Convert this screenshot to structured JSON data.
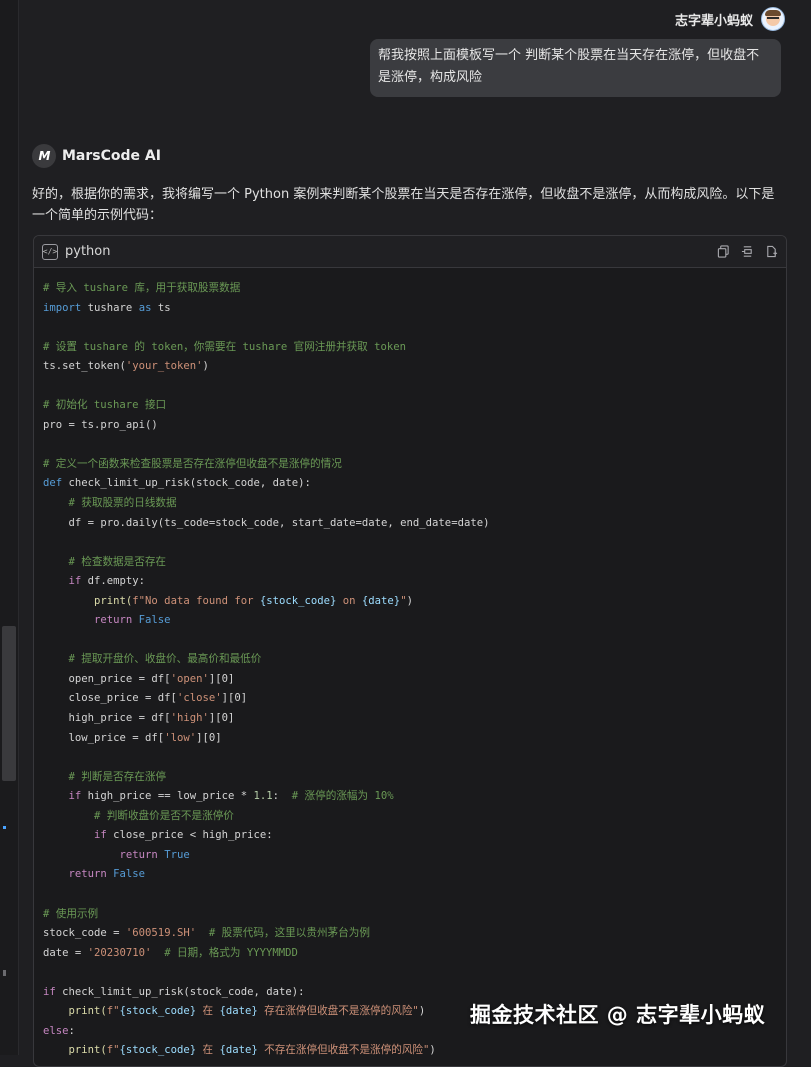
{
  "user": {
    "name": "志字辈小蚂蚁",
    "message": "帮我按照上面模板写一个 判断某个股票在当天存在涨停，但收盘不是涨停，构成风险"
  },
  "assistant": {
    "name": "MarsCode AI",
    "logo_text": "M",
    "intro": "好的，根据你的需求，我将编写一个 Python 案例来判断某个股票在当天是否存在涨停，但收盘不是涨停，从而构成风险。以下是一个简单的示例代码："
  },
  "code": {
    "language": "python",
    "actions": [
      "copy-icon",
      "insert-icon",
      "new-file-icon"
    ],
    "lines": {
      "l1": "# 导入 tushare 库，用于获取股票数据",
      "l2a": "import",
      "l2b": " tushare ",
      "l2c": "as",
      "l2d": " ts",
      "l4": "# 设置 tushare 的 token，你需要在 tushare 官网注册并获取 token",
      "l5a": "ts.set_token(",
      "l5b": "'your_token'",
      "l5c": ")",
      "l7": "# 初始化 tushare 接口",
      "l8": "pro = ts.pro_api()",
      "l10": "# 定义一个函数来检查股票是否存在涨停但收盘不是涨停的情况",
      "l11a": "def",
      "l11b": " check_limit_up_risk(stock_code, date):",
      "l12": "    # 获取股票的日线数据",
      "l13": "    df = pro.daily(ts_code=stock_code, start_date=date, end_date=date)",
      "l15": "    # 检查数据是否存在",
      "l16a": "    if",
      "l16b": " df.empty:",
      "l17a": "        print(",
      "l17b": "f\"No data found for ",
      "l17c": "{stock_code}",
      "l17d": " on ",
      "l17e": "{date}",
      "l17f": "\"",
      "l17g": ")",
      "l18a": "        return",
      "l18b": " False",
      "l20": "    # 提取开盘价、收盘价、最高价和最低价",
      "l21a": "    open_price = df[",
      "l21b": "'open'",
      "l21c": "][0]",
      "l22a": "    close_price = df[",
      "l22b": "'close'",
      "l22c": "][0]",
      "l23a": "    high_price = df[",
      "l23b": "'high'",
      "l23c": "][0]",
      "l24a": "    low_price = df[",
      "l24b": "'low'",
      "l24c": "][0]",
      "l26": "    # 判断是否存在涨停",
      "l27a": "    if",
      "l27b": " high_price == low_price * ",
      "l27c": "1.1",
      "l27d": ":  ",
      "l27e": "# 涨停的涨幅为 10%",
      "l28": "        # 判断收盘价是否不是涨停价",
      "l29a": "        if",
      "l29b": " close_price < high_price:",
      "l30a": "            return",
      "l30b": " True",
      "l31a": "    return",
      "l31b": " False",
      "l33": "# 使用示例",
      "l34a": "stock_code = ",
      "l34b": "'600519.SH'",
      "l34c": "  ",
      "l34d": "# 股票代码，这里以贵州茅台为例",
      "l35a": "date = ",
      "l35b": "'20230710'",
      "l35c": "  ",
      "l35d": "# 日期，格式为 YYYYMMDD",
      "l37a": "if",
      "l37b": " check_limit_up_risk(stock_code, date):",
      "l38a": "    print(",
      "l38b": "f\"",
      "l38c": "{stock_code}",
      "l38d": " 在 ",
      "l38e": "{date}",
      "l38f": " 存在涨停但收盘不是涨停的风险\"",
      "l38g": ")",
      "l39a": "else",
      "l39b": ":",
      "l40a": "    print(",
      "l40b": "f\"",
      "l40c": "{stock_code}",
      "l40d": " 在 ",
      "l40e": "{date}",
      "l40f": " 不存在涨停但收盘不是涨停的风险\"",
      "l40g": ")"
    }
  },
  "watermark": "掘金技术社区 @ 志字辈小蚂蚁"
}
